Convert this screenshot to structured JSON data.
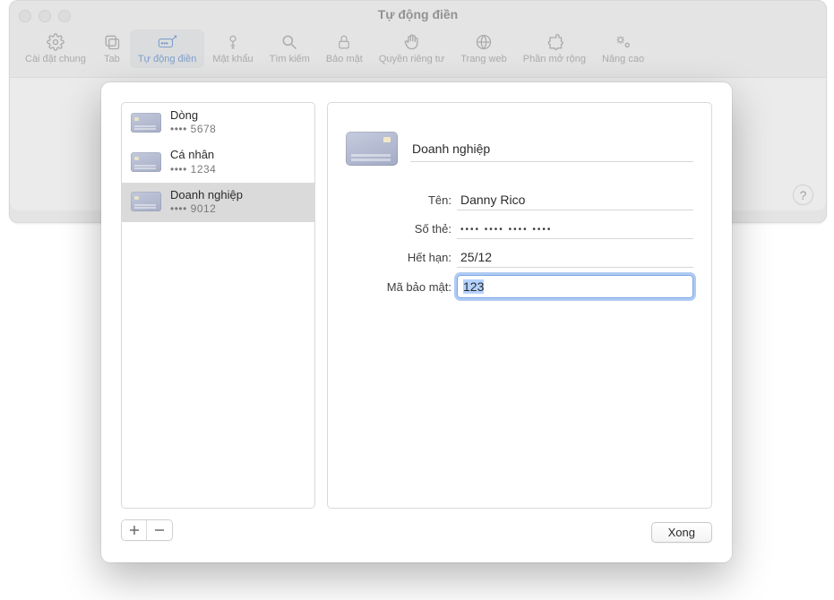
{
  "window": {
    "title": "Tự động điền"
  },
  "toolbar": [
    {
      "id": "general",
      "label": "Cài đặt chung"
    },
    {
      "id": "tabs",
      "label": "Tab"
    },
    {
      "id": "autofill",
      "label": "Tự động điền",
      "selected": true
    },
    {
      "id": "passwords",
      "label": "Mật khẩu"
    },
    {
      "id": "search",
      "label": "Tìm kiếm"
    },
    {
      "id": "security",
      "label": "Bảo mật"
    },
    {
      "id": "privacy",
      "label": "Quyền riêng tư"
    },
    {
      "id": "websites",
      "label": "Trang web"
    },
    {
      "id": "extensions",
      "label": "Phần mở rộng"
    },
    {
      "id": "advanced",
      "label": "Nâng cao"
    }
  ],
  "help_symbol": "?",
  "cards": [
    {
      "name": "Dòng",
      "masked": "•••• 5678"
    },
    {
      "name": "Cá nhân",
      "masked": "•••• 1234"
    },
    {
      "name": "Doanh nghiệp",
      "masked": "•••• 9012",
      "selected": true
    }
  ],
  "form": {
    "description": "Doanh nghiệp",
    "labels": {
      "name": "Tên:",
      "number": "Số thẻ:",
      "expiry": "Hết hạn:",
      "cvv": "Mã bảo mật:"
    },
    "values": {
      "name": "Danny Rico",
      "number": "•••• •••• •••• ••••",
      "expiry": "25/12",
      "cvv": "123"
    }
  },
  "buttons": {
    "done": "Xong",
    "add": "+",
    "remove": "−"
  }
}
